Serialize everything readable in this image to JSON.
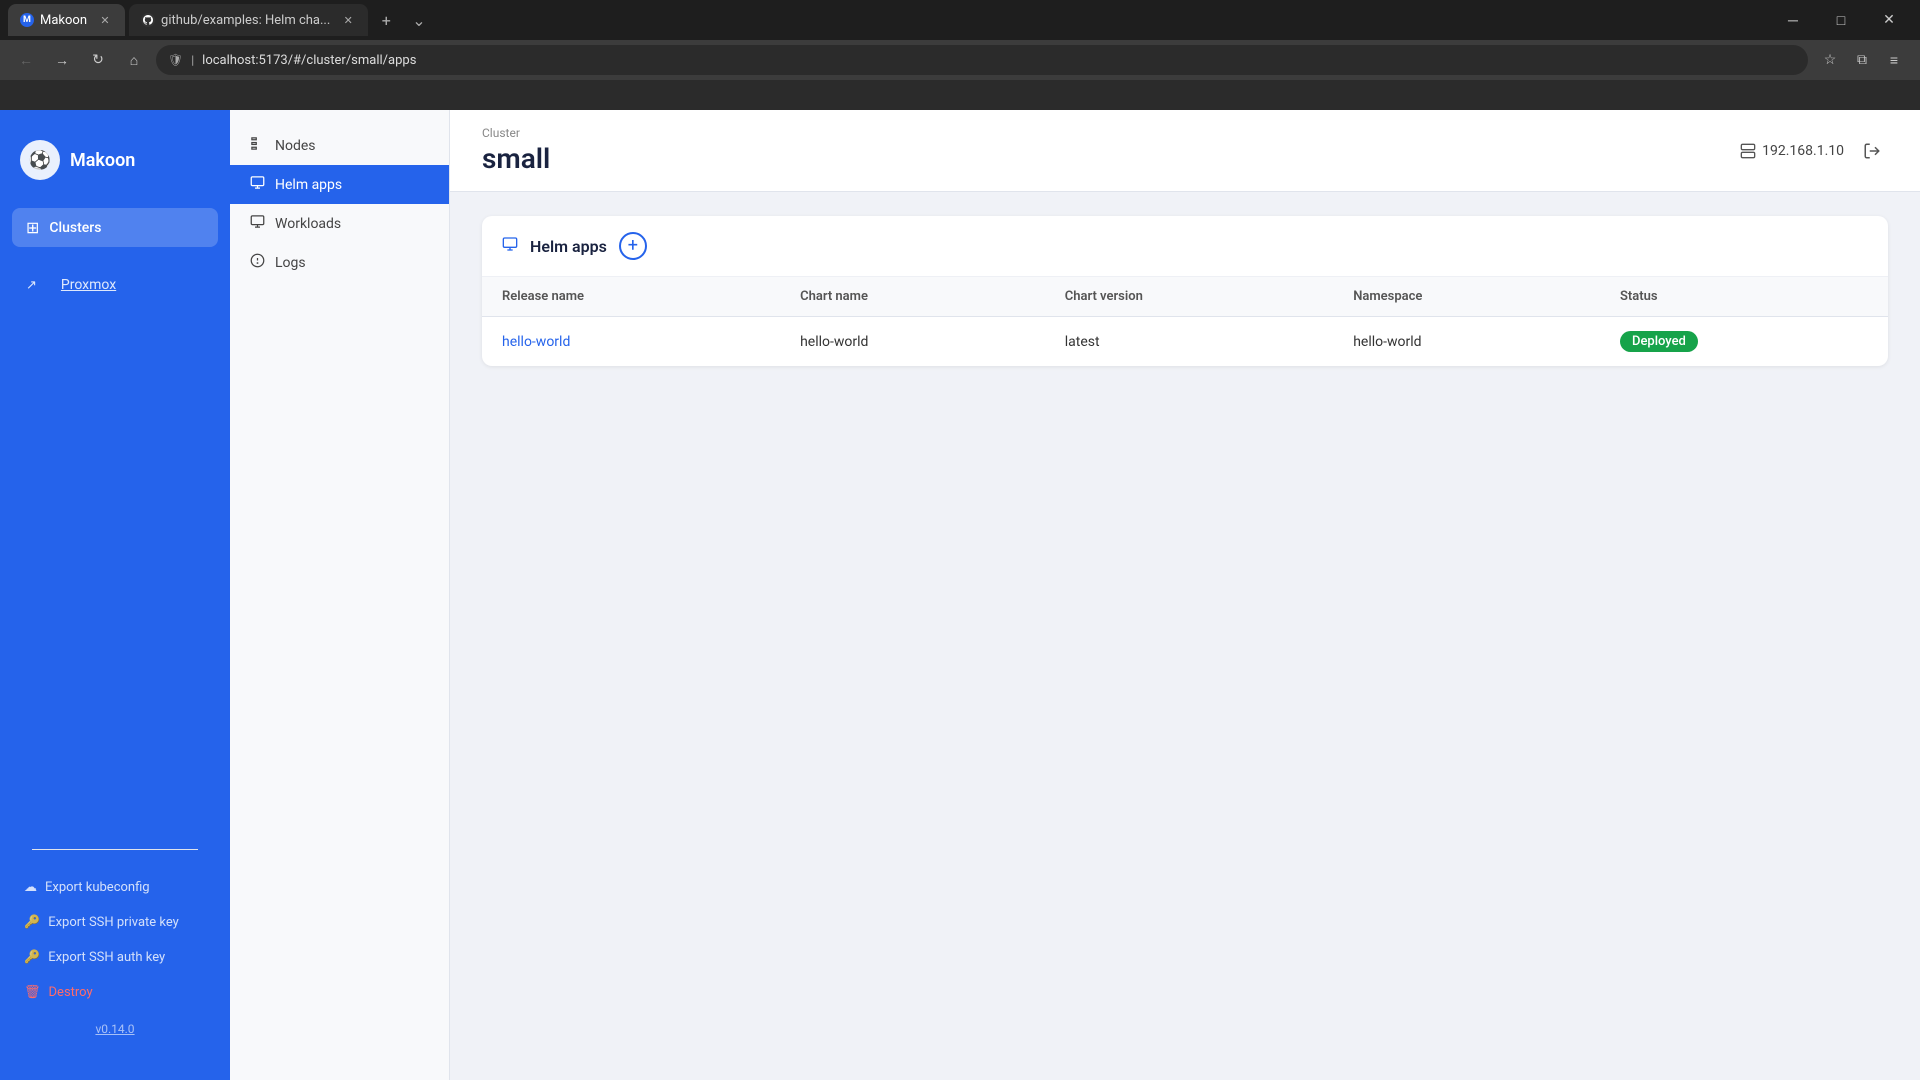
{
  "browser": {
    "tabs": [
      {
        "id": "makoon",
        "title": "Makoon",
        "favicon": "M",
        "active": true,
        "closable": true
      },
      {
        "id": "github",
        "title": "github/examples: Helm cha...",
        "favicon": "G",
        "active": false,
        "closable": true
      }
    ],
    "address": "localhost:5173/#/cluster/small/apps",
    "window_controls": [
      "minimize",
      "maximize",
      "close"
    ]
  },
  "sidebar": {
    "brand_name": "Makoon",
    "nav_items": [
      {
        "id": "clusters",
        "label": "Clusters",
        "icon": "⊞",
        "active": true
      }
    ],
    "cluster_items": [
      {
        "id": "proxmox",
        "label": "Proxmox",
        "icon": "↗",
        "is_link": true
      }
    ],
    "bottom_links": [
      {
        "id": "export-kubeconfig",
        "label": "Export kubeconfig",
        "icon": "☁"
      },
      {
        "id": "export-ssh-private",
        "label": "Export SSH private key",
        "icon": "🔑"
      },
      {
        "id": "export-ssh-auth",
        "label": "Export SSH auth key",
        "icon": "🔑"
      },
      {
        "id": "destroy",
        "label": "Destroy",
        "icon": "🗑",
        "danger": true
      }
    ],
    "version": "v0.14.0"
  },
  "secondary_nav": {
    "items": [
      {
        "id": "nodes",
        "label": "Nodes",
        "icon": "☰",
        "active": false
      },
      {
        "id": "helm-apps",
        "label": "Helm apps",
        "icon": "🖥",
        "active": true
      },
      {
        "id": "workloads",
        "label": "Workloads",
        "icon": "🖥",
        "active": false
      },
      {
        "id": "logs",
        "label": "Logs",
        "icon": "⊙",
        "active": false
      }
    ]
  },
  "main": {
    "breadcrumb": "Cluster",
    "cluster_name": "small",
    "ip_address": "192.168.1.10",
    "helm_apps_section": {
      "title": "Helm apps",
      "table": {
        "columns": [
          {
            "id": "release-name",
            "label": "Release name"
          },
          {
            "id": "chart-name",
            "label": "Chart name"
          },
          {
            "id": "chart-version",
            "label": "Chart version"
          },
          {
            "id": "namespace",
            "label": "Namespace"
          },
          {
            "id": "status",
            "label": "Status"
          }
        ],
        "rows": [
          {
            "release_name": "hello-world",
            "chart_name": "hello-world",
            "chart_version": "latest",
            "namespace": "hello-world",
            "status": "Deployed",
            "status_type": "deployed"
          }
        ]
      }
    }
  }
}
